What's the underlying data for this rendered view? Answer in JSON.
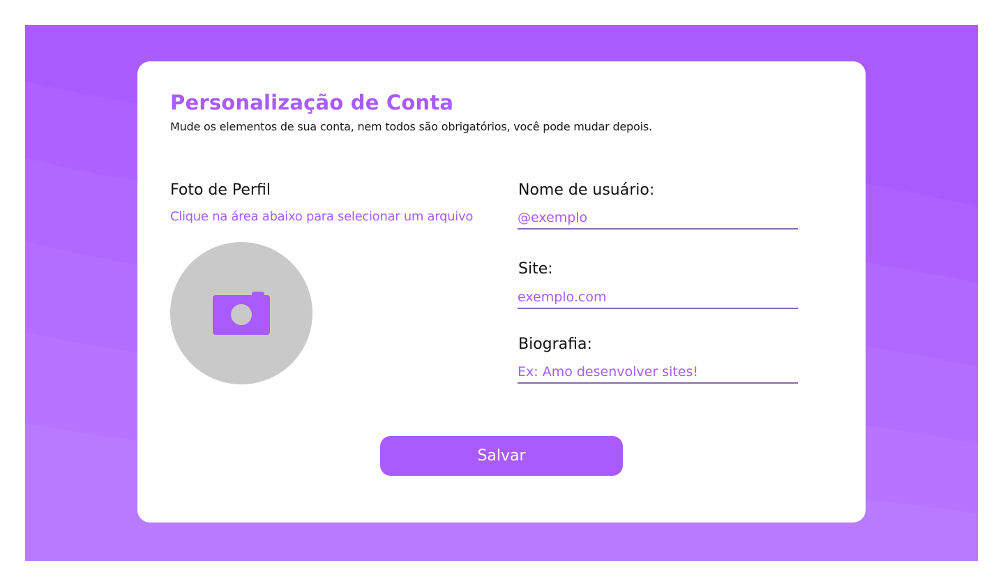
{
  "colors": {
    "accent": "#a95bff",
    "background": "#a95bff",
    "avatar_placeholder": "#c9c9c9",
    "input_underline": "#8a6ab0"
  },
  "header": {
    "title": "Personalização de Conta",
    "subtitle": "Mude os elementos de sua conta, nem todos são obrigatórios, você pode mudar depois."
  },
  "profile_photo": {
    "label": "Foto de Perfil",
    "hint": "Clique na área abaixo para selecionar um arquivo",
    "icon": "camera-icon"
  },
  "form": {
    "username": {
      "label": "Nome de usuário:",
      "placeholder": "@exemplo",
      "value": ""
    },
    "site": {
      "label": "Site:",
      "placeholder": "exemplo.com",
      "value": ""
    },
    "bio": {
      "label": "Biografia:",
      "placeholder": "Ex: Amo desenvolver sites!",
      "value": ""
    }
  },
  "actions": {
    "save_label": "Salvar"
  }
}
